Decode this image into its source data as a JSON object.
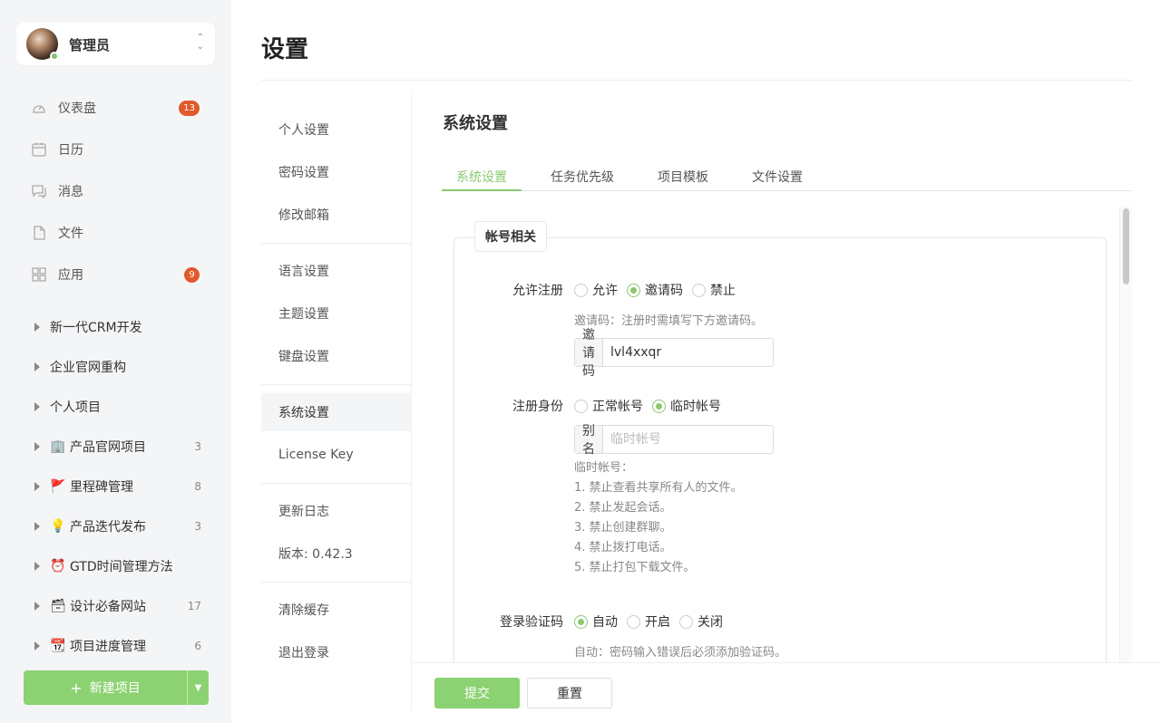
{
  "user": {
    "name": "管理员",
    "status_color": "#7bc46a"
  },
  "nav": [
    {
      "label": "仪表盘",
      "icon": "dashboard-icon",
      "badge": "13"
    },
    {
      "label": "日历",
      "icon": "calendar-icon",
      "badge": ""
    },
    {
      "label": "消息",
      "icon": "message-icon",
      "badge": ""
    },
    {
      "label": "文件",
      "icon": "file-icon",
      "badge": ""
    },
    {
      "label": "应用",
      "icon": "apps-icon",
      "badge": "9"
    }
  ],
  "projects": [
    {
      "emoji": "",
      "name": "新一代CRM开发",
      "count": ""
    },
    {
      "emoji": "",
      "name": "企业官网重构",
      "count": ""
    },
    {
      "emoji": "",
      "name": "个人项目",
      "count": ""
    },
    {
      "emoji": "🏢",
      "name": "产品官网项目",
      "count": "3"
    },
    {
      "emoji": "🚩",
      "name": "里程碑管理",
      "count": "8"
    },
    {
      "emoji": "💡",
      "name": "产品迭代发布",
      "count": "3"
    },
    {
      "emoji": "⏰",
      "name": "GTD时间管理方法",
      "count": ""
    },
    {
      "emoji": "🗃",
      "name": "设计必备网站",
      "count": "17"
    },
    {
      "emoji": "📆",
      "name": "项目进度管理",
      "count": "6"
    }
  ],
  "new_project_label": "新建项目",
  "page_title": "设置",
  "settings_menu": {
    "group1": [
      "个人设置",
      "密码设置",
      "修改邮箱"
    ],
    "group2": [
      "语言设置",
      "主题设置",
      "键盘设置"
    ],
    "group3": [
      "系统设置",
      "License Key"
    ],
    "group4": [
      "更新日志",
      "版本: 0.42.3"
    ],
    "group5": [
      "清除缓存",
      "退出登录"
    ]
  },
  "panel_title": "系统设置",
  "tabs": [
    "系统设置",
    "任务优先级",
    "项目模板",
    "文件设置"
  ],
  "section": {
    "legend": "帐号相关",
    "register": {
      "label": "允许注册",
      "options": [
        "允许",
        "邀请码",
        "禁止"
      ],
      "selected": "邀请码",
      "hint": "邀请码：注册时需填写下方邀请码。",
      "addon": "邀请码",
      "value": "lvl4xxqr"
    },
    "identity": {
      "label": "注册身份",
      "options": [
        "正常帐号",
        "临时帐号"
      ],
      "selected": "临时帐号",
      "addon": "别名",
      "placeholder": "临时帐号",
      "rules_title": "临时帐号：",
      "rules": [
        "1.  禁止查看共享所有人的文件。",
        "2.  禁止发起会话。",
        "3.  禁止创建群聊。",
        "4.  禁止拨打电话。",
        "5.  禁止打包下载文件。"
      ]
    },
    "captcha": {
      "label": "登录验证码",
      "options": [
        "自动",
        "开启",
        "关闭"
      ],
      "selected": "自动",
      "hint": "自动：密码输入错误后必须添加验证码。"
    }
  },
  "buttons": {
    "submit": "提交",
    "reset": "重置"
  },
  "colors": {
    "accent": "#8cc871",
    "badge": "#e05a2b"
  }
}
